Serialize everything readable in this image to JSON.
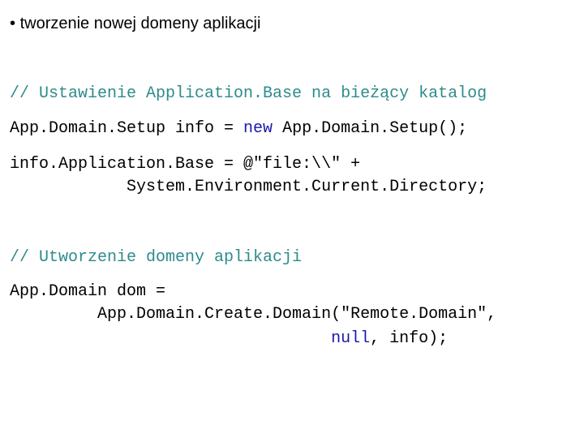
{
  "heading": {
    "bullet": "•",
    "text": "tworzenie nowej domeny aplikacji"
  },
  "code": {
    "line1_comment": "// Ustawienie Application.Base na bieżący katalog",
    "line2_a": "App.Domain.Setup info = ",
    "line2_kw": "new",
    "line2_b": " App.Domain.Setup();",
    "line3": "info.Application.Base = @\"file:\\\\\" +",
    "line4": "            System.Environment.Current.Directory;",
    "line5_comment": "// Utworzenie domeny aplikacji",
    "line6": "App.Domain dom =",
    "line7": "         App.Domain.Create.Domain(\"Remote.Domain\",",
    "line8_indent": "                                 ",
    "line8_kw": "null",
    "line8_rest": ", info);"
  },
  "colors": {
    "comment": "#2e8b8b",
    "keyword": "#1a1aa6",
    "text": "#000000"
  }
}
